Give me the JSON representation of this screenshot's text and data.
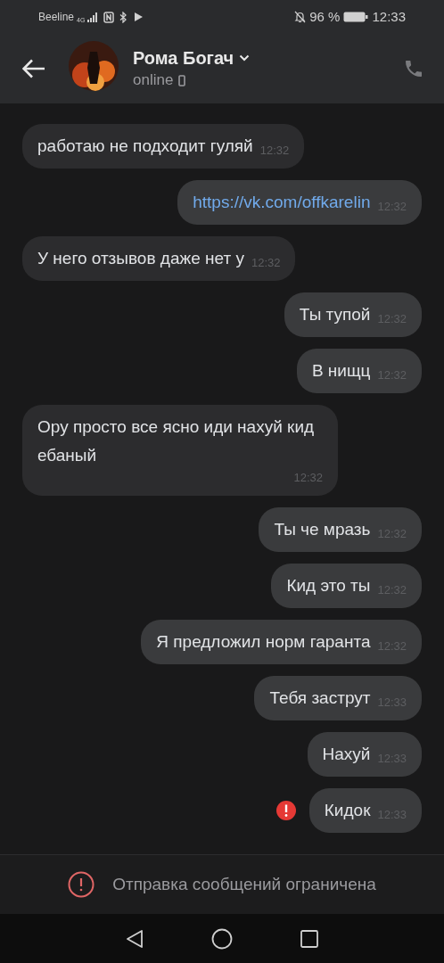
{
  "status_bar": {
    "carrier": "Beeline",
    "network": "4G",
    "battery": "96 %",
    "time": "12:33"
  },
  "header": {
    "name": "Рома Богач",
    "status": "online"
  },
  "messages": [
    {
      "kind": "text",
      "text": "работаю не подходит гуляй",
      "time": "12:32",
      "outgoing": false,
      "failed": false
    },
    {
      "kind": "link",
      "text": "https://vk.com/offkarelin",
      "time": "12:32",
      "outgoing": true,
      "failed": false
    },
    {
      "kind": "text",
      "text": "У него отзывов даже нет у",
      "time": "12:32",
      "outgoing": false,
      "failed": false
    },
    {
      "kind": "text",
      "text": "Ты тупой",
      "time": "12:32",
      "outgoing": true,
      "failed": false
    },
    {
      "kind": "text",
      "text": "В нищц",
      "time": "12:32",
      "outgoing": true,
      "failed": false
    },
    {
      "kind": "text",
      "text": "Ору просто все ясно иди нахуй кид ебаный",
      "time": "12:32",
      "outgoing": false,
      "failed": false
    },
    {
      "kind": "text",
      "text": "Ты че мразь",
      "time": "12:32",
      "outgoing": true,
      "failed": false
    },
    {
      "kind": "text",
      "text": "Кид это ты",
      "time": "12:32",
      "outgoing": true,
      "failed": false
    },
    {
      "kind": "text",
      "text": "Я предложил норм гаранта",
      "time": "12:32",
      "outgoing": true,
      "failed": false
    },
    {
      "kind": "text",
      "text": "Тебя заструт",
      "time": "12:33",
      "outgoing": true,
      "failed": false
    },
    {
      "kind": "text",
      "text": "Нахуй",
      "time": "12:33",
      "outgoing": true,
      "failed": false
    },
    {
      "kind": "text",
      "text": "Кидок",
      "time": "12:33",
      "outgoing": true,
      "failed": true
    }
  ],
  "notice": "Отправка сообщений ограничена"
}
